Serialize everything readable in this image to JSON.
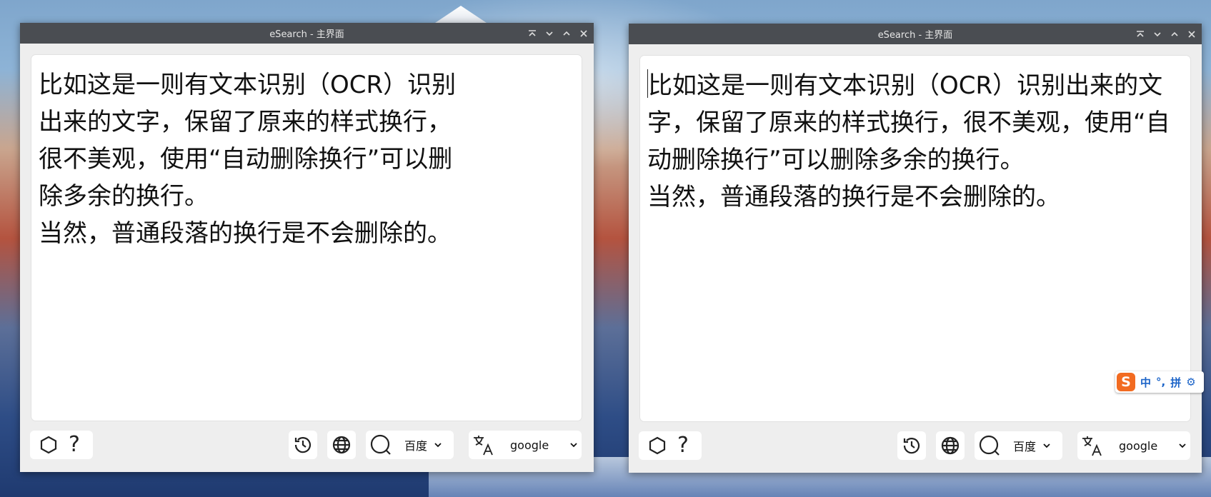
{
  "windows": [
    {
      "title": "eSearch - 主界面",
      "text_paragraphs": [
        "比如这是一则有文本识别（OCR）识别出来的文字，保留了原来的样式换行，很不美观，使用“自动删除换行”可以删除多余的换行。",
        "当然，普通段落的换行是不会删除的。"
      ],
      "search_engine": "百度",
      "translate_engine": "google"
    },
    {
      "title": "eSearch - 主界面",
      "text_paragraphs": [
        "比如这是一则有文本识别（OCR）识别出来的文字，保留了原来的样式换行，很不美观，使用“自动删除换行”可以删除多余的换行。",
        "当然，普通段落的换行是不会删除的。"
      ],
      "search_engine": "百度",
      "translate_engine": "google"
    }
  ],
  "ime_toolbar": {
    "logo": "S",
    "mode": "中",
    "punct": "°,",
    "input": "拼"
  },
  "icons": {
    "titlebar": [
      "keep-on-top-icon",
      "minimize-icon",
      "maximize-icon",
      "close-icon"
    ],
    "bottombar": [
      "hexagon-icon",
      "help-icon",
      "history-icon",
      "globe-icon",
      "search-icon",
      "translate-icon"
    ]
  }
}
